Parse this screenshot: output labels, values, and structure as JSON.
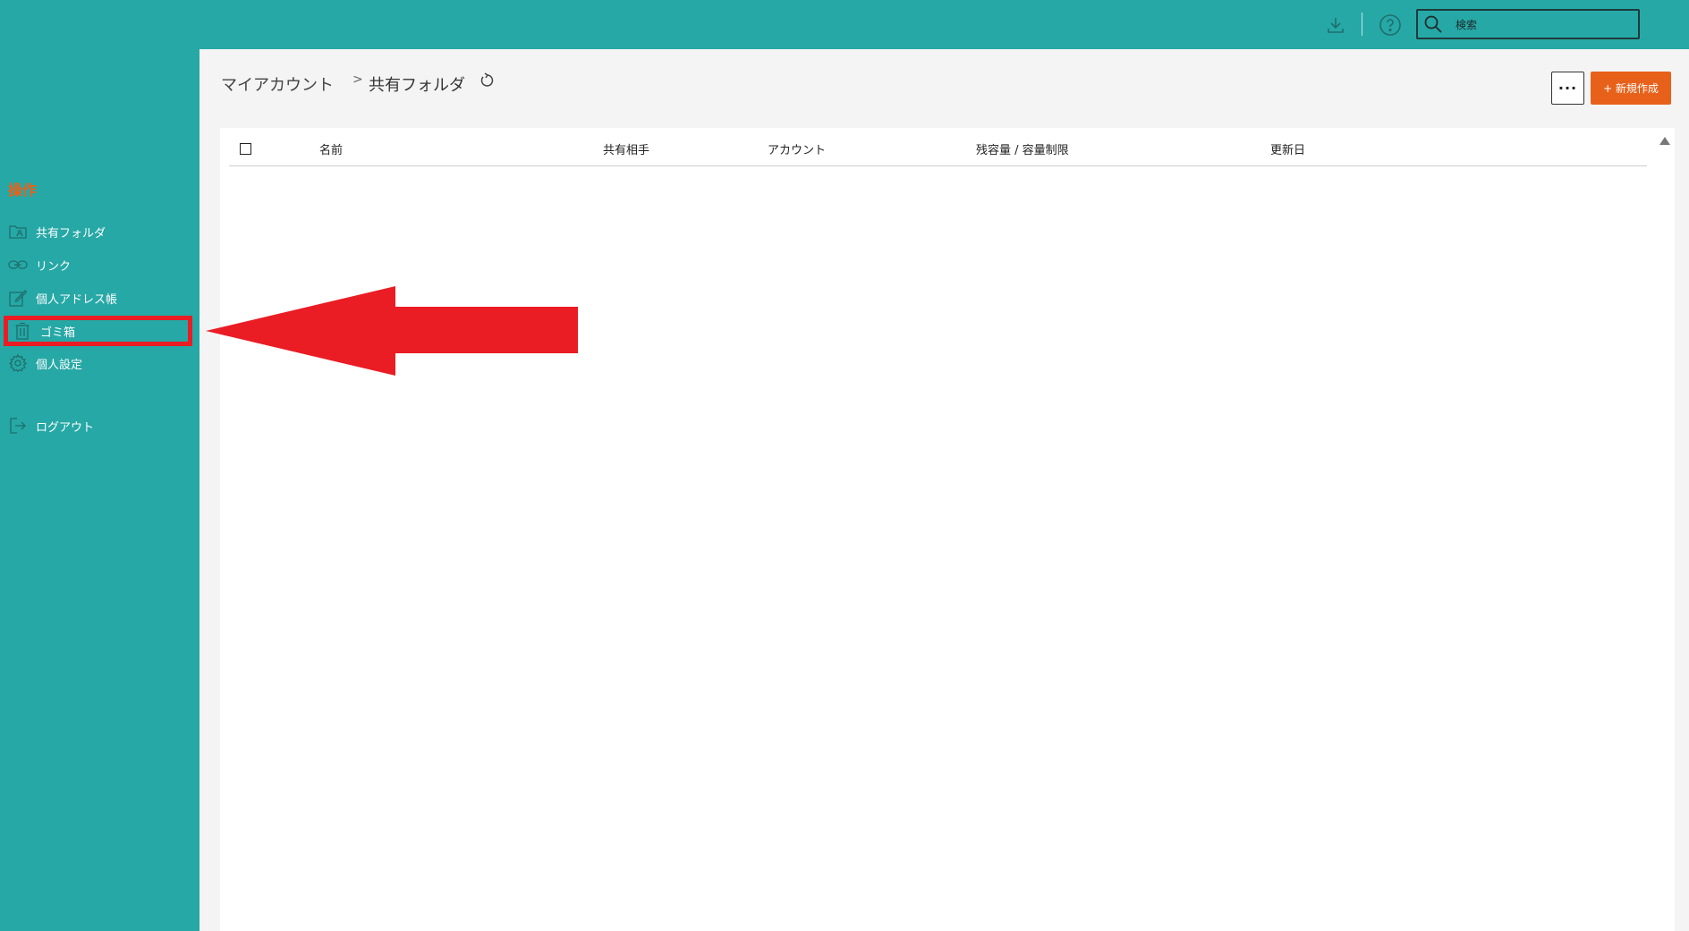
{
  "topbar": {
    "search_placeholder": "検索"
  },
  "sidebar": {
    "heading": "操作",
    "items": [
      {
        "label": "共有フォルダ",
        "icon": "shared-folder-icon"
      },
      {
        "label": "リンク",
        "icon": "link-icon"
      },
      {
        "label": "個人アドレス帳",
        "icon": "address-book-icon"
      },
      {
        "label": "ゴミ箱",
        "icon": "trash-icon",
        "selected": true
      },
      {
        "label": "個人設定",
        "icon": "gear-icon"
      },
      {
        "label": "ログアウト",
        "icon": "logout-icon"
      }
    ]
  },
  "main": {
    "breadcrumb_root": "マイアカウント",
    "breadcrumb_separator": ">",
    "breadcrumb_current": "共有フォルダ",
    "more_label": "···",
    "new_button_label": "+ 新規作成"
  },
  "table": {
    "columns": [
      "名前",
      "共有相手",
      "アカウント",
      "残容量 / 容量制限",
      "更新日"
    ]
  },
  "colors": {
    "teal": "#26a8a6",
    "accent_orange": "#e8611a",
    "highlight_red": "#ea1c24"
  }
}
